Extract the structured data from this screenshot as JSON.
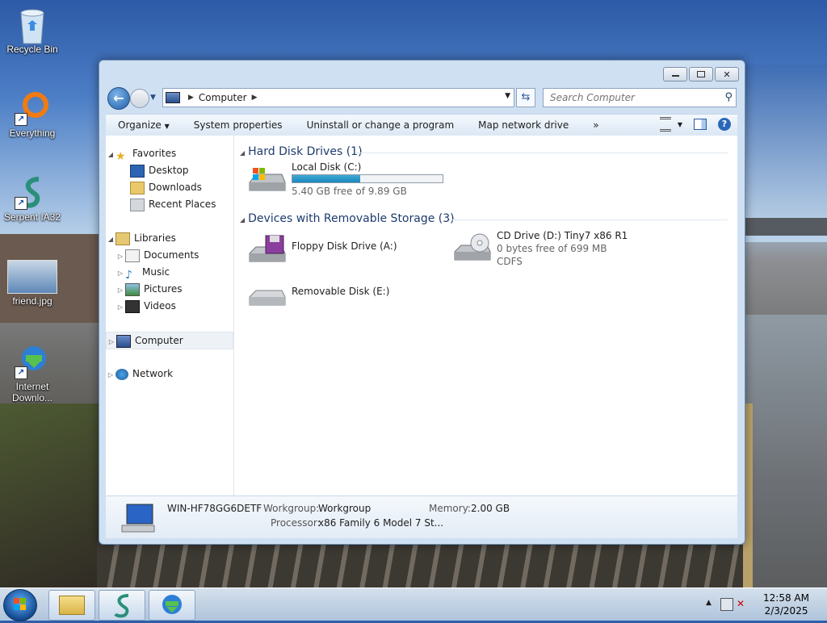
{
  "desktop": {
    "icons": [
      {
        "label": "Recycle Bin"
      },
      {
        "label": "Everything"
      },
      {
        "label": "Serpent IA32"
      },
      {
        "label": "friend.jpg"
      },
      {
        "label": "Internet Downlo..."
      }
    ]
  },
  "window": {
    "address": {
      "path_label": "Computer"
    },
    "search": {
      "placeholder": "Search Computer"
    },
    "toolbar": {
      "organize": "Organize",
      "system_properties": "System properties",
      "uninstall": "Uninstall or change a program",
      "map_drive": "Map network drive",
      "more": "»"
    },
    "navpane": {
      "favorites": "Favorites",
      "desktop": "Desktop",
      "downloads": "Downloads",
      "recent_places": "Recent Places",
      "libraries": "Libraries",
      "documents": "Documents",
      "music": "Music",
      "pictures": "Pictures",
      "videos": "Videos",
      "computer": "Computer",
      "network": "Network"
    },
    "content": {
      "hdd_group": "Hard Disk Drives (1)",
      "removable_group": "Devices with Removable Storage (3)",
      "local_disk": {
        "name": "Local Disk (C:)",
        "free": "5.40 GB free of 9.89 GB",
        "used_fraction": 0.454
      },
      "floppy": {
        "name": "Floppy Disk Drive (A:)"
      },
      "cd": {
        "name": "CD Drive (D:) Tiny7 x86 R1",
        "free": "0 bytes free of 699 MB",
        "fs": "CDFS"
      },
      "removable": {
        "name": "Removable Disk (E:)"
      }
    },
    "details": {
      "computer_name": "WIN-HF78GG6DETF",
      "workgroup_label": "Workgroup:",
      "workgroup_value": "Workgroup",
      "memory_label": "Memory:",
      "memory_value": "2.00 GB",
      "processor_label": "Processor:",
      "processor_value": "x86 Family 6 Model 7 St..."
    }
  },
  "taskbar": {
    "time": "12:58 AM",
    "date": "2/3/2025"
  }
}
